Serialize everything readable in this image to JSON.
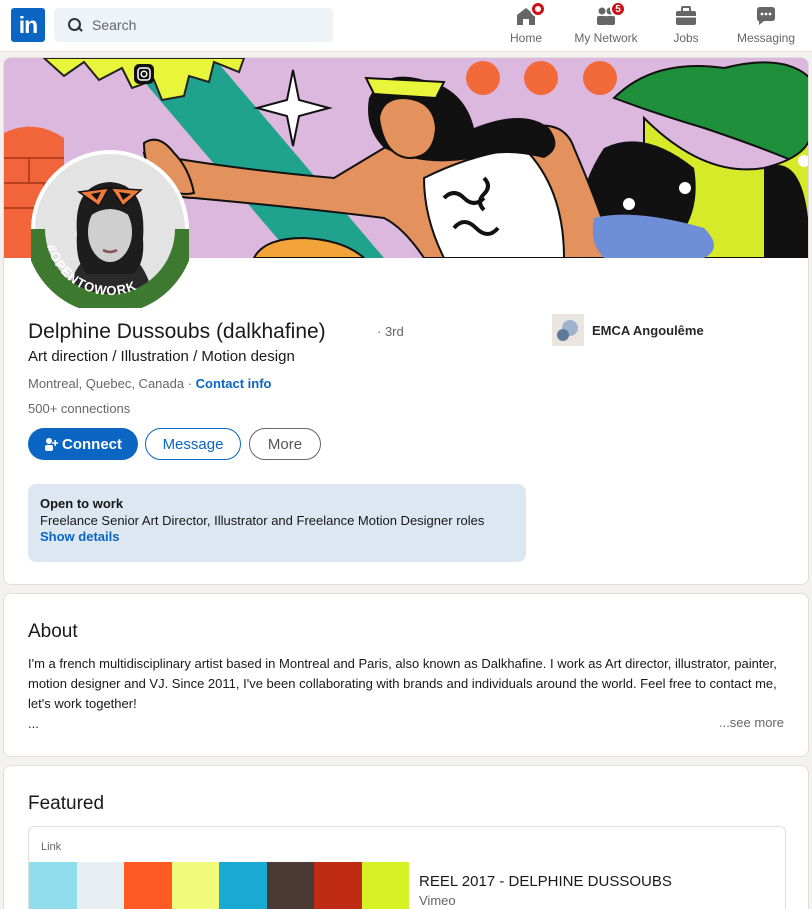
{
  "nav": {
    "logo": "in",
    "search_placeholder": "Search",
    "items": [
      {
        "label": "Home",
        "icon": "home-icon",
        "badge": ""
      },
      {
        "label": "My Network",
        "icon": "network-icon",
        "badge": "5"
      },
      {
        "label": "Jobs",
        "icon": "briefcase-icon",
        "badge": ""
      },
      {
        "label": "Messaging",
        "icon": "messaging-icon",
        "badge": ""
      }
    ]
  },
  "profile": {
    "name": "Delphine Dussoubs (dalkhafine)",
    "degree": "· 3rd",
    "headline": "Art direction / Illustration / Motion design",
    "location": "Montreal, Quebec, Canada",
    "location_sep": " · ",
    "contact_info": "Contact info",
    "connections": "500+ connections",
    "avatar_frame_text": "#OPENTOWORK",
    "buttons": {
      "connect": "Connect",
      "message": "Message",
      "more": "More"
    },
    "company": "EMCA Angoulême",
    "open_to_work": {
      "title": "Open to work",
      "roles": "Freelance Senior Art Director, Illustrator and Freelance Motion Designer roles",
      "link": "Show details"
    }
  },
  "about": {
    "title": "About",
    "text": "I'm a french multidisciplinary artist based in Montreal and Paris, also known as Dalkhafine. I work as Art director, illustrator, painter, motion designer and VJ. Since 2011, I've been collaborating with brands and individuals around the world. Feel free to contact me, let's work together!",
    "ellipsis": "...",
    "see_more": "...see more"
  },
  "featured": {
    "title": "Featured",
    "item": {
      "type": "Link",
      "title": "REEL 2017 - DELPHINE DUSSOUBS",
      "source": "Vimeo",
      "swatch_colors": [
        "#8fdcea",
        "#e9eef2",
        "#ff5a26",
        "#f2fa7c",
        "#19a9d3",
        "#4a3a33",
        "#bf2c13",
        "#d6f224"
      ]
    }
  },
  "colors": {
    "brand": "#0a66c2",
    "badge": "#cc1016",
    "open_to_work_ring": "#3d7a2f",
    "banner_bg": "#dcb7de"
  }
}
